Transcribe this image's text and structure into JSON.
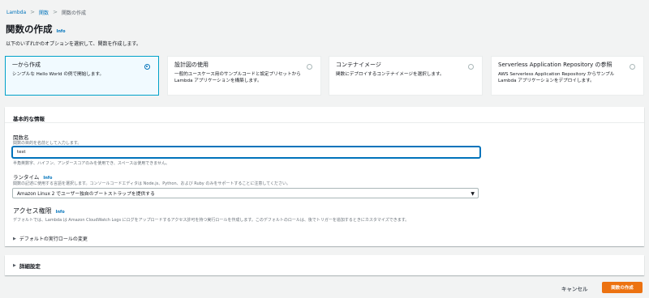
{
  "breadcrumb": {
    "root": "Lambda",
    "sep": ">",
    "functions": "関数",
    "current": "関数の作成"
  },
  "page": {
    "title": "関数の作成",
    "info": "Info",
    "description": "以下のいずれかのオプションを選択して、関数を作成します。"
  },
  "options": [
    {
      "title": "一から作成",
      "desc": "シンプルな Hello World の例で開始します。"
    },
    {
      "title": "設計図の使用",
      "desc": "一般的ユースケース用のサンプルコードと設定プリセットから Lambda アプリケーションを構築します。"
    },
    {
      "title": "コンテナイメージ",
      "desc": "関数にデプロイするコンテナイメージを選択します。"
    },
    {
      "title": "Serverless Application Repository の参照",
      "desc": "AWS Serverless Application Repository からサンプル Lambda アプリケーションをデプロイします。"
    }
  ],
  "basic": {
    "header": "基本的な情報",
    "name_label": "関数名",
    "name_desc": "関数の目的を名前として入力します。",
    "name_value": "test",
    "name_hint": "半角英数字、ハイフン、アンダースコアのみを使用でき、スペースは使用できません。",
    "runtime_label": "ランタイム",
    "runtime_info": "Info",
    "runtime_desc": "関数の記述に使用する言語を選択します。コンソールコードエディタは Node.js、Python、および Ruby のみをサポートすることに注意してください。",
    "runtime_value": "Amazon Linux 2 でユーザー独自のブートストラップを提供する",
    "access_label": "アクセス権限",
    "access_info": "Info",
    "access_desc": "デフォルトでは、Lambda は Amazon CloudWatch Logs にログをアップロードするアクセス許可を持つ実行ロールを作成します。このデフォルトのロールは、後でトリガーを追加するときにカスタマイズできます。",
    "role_expander": "デフォルトの実行ロールの変更"
  },
  "advanced": {
    "label": "詳細設定"
  },
  "footer": {
    "cancel": "キャンセル",
    "create": "関数の作成"
  },
  "icons": {
    "caret": "▶",
    "dropdown": "▼"
  },
  "colors": {
    "accent": "#0073bb",
    "primary_button": "#ec7211",
    "selected_bg": "#f1faff"
  }
}
